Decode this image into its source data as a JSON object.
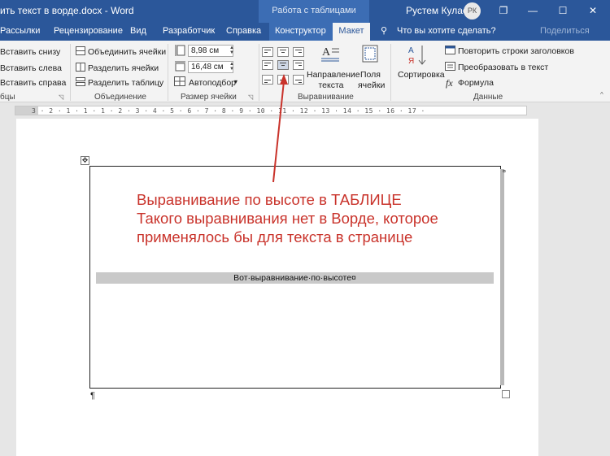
{
  "titlebar": {
    "doc_title": "ить текст в ворде.docx - Word",
    "table_tools": "Работа с таблицами",
    "user_name": "Рустем Кулаев",
    "avatar": "РК",
    "minimize": "—",
    "restore": "❐",
    "maximize": "☐",
    "close": "✕"
  },
  "tabs": {
    "items": [
      "Рассылки",
      "Рецензирование",
      "Вид",
      "Разработчик",
      "Справка",
      "Конструктор",
      "Макет"
    ],
    "tell_me": "Что вы хотите сделать?",
    "share": "Поделиться"
  },
  "ribbon": {
    "rows_cols": {
      "insert_below": "Вставить снизу",
      "insert_left": "Вставить слева",
      "insert_right": "Вставить справа",
      "label": "бцы"
    },
    "merge": {
      "merge_cells": "Объединить ячейки",
      "split_cells": "Разделить ячейки",
      "split_table": "Разделить таблицу",
      "label": "Объединение"
    },
    "cell_size": {
      "height": "8,98 см",
      "width": "16,48 см",
      "autofit": "Автоподбор",
      "label": "Размер ячейки"
    },
    "alignment": {
      "text_direction_1": "Направление",
      "text_direction_2": "текста",
      "margins_1": "Поля",
      "margins_2": "ячейки",
      "label": "Выравнивание"
    },
    "data": {
      "sort": "Сортировка",
      "repeat_header": "Повторить строки заголовков",
      "convert": "Преобразовать в текст",
      "formula": "Формула",
      "label": "Данные"
    }
  },
  "ruler": {
    "marks": "3 · 2 · 1 · 1 · 1 · 2 · 3 · 4 · 5 · 6 · 7 · 8 · 9 · 10 · 11 · 12 · 13 · 14 · 15 · 16 · 17 ·"
  },
  "document": {
    "annotation_line1": "Выравнивание по высоте в ТАБЛИЦЕ",
    "annotation_line2": "Такого выравнивания нет в Ворде, которое",
    "annotation_line3": "применялось бы для текста в странице",
    "cell_text": "Вот·выравнивание·по·высоте¤",
    "pilcrow": "¶",
    "move_handle": "✥"
  },
  "colors": {
    "title_blue": "#2b579a",
    "annotation_red": "#c9332b"
  }
}
